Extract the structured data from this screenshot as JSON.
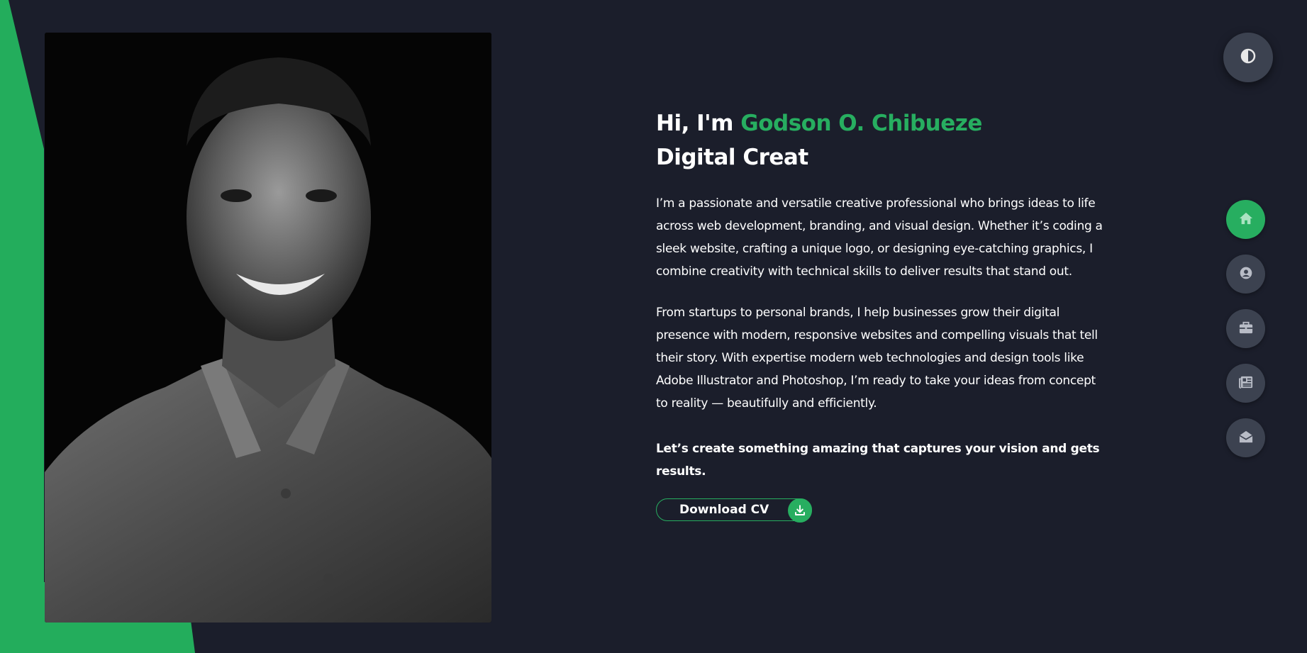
{
  "hero": {
    "greeting": "Hi, I'm ",
    "name": "Godson O. Chibueze",
    "role": "Digital Creat",
    "paragraph_1": "I’m a passionate and versatile creative professional who brings ideas to life across web development, branding, and visual design. Whether it’s coding a sleek website, crafting a unique logo, or designing eye-catching graphics, I combine creativity with technical skills to deliver results that stand out.",
    "paragraph_2": "From startups to personal brands, I help businesses grow their digital presence with modern, responsive websites and compelling visuals that tell their story. With expertise modern web technologies and design tools like Adobe Illustrator and Photoshop, I’m ready to take your ideas from concept to reality — beautifully and efficiently.",
    "tagline": "Let’s create something amazing that captures your vision and gets results.",
    "cv_button_label": "Download CV"
  },
  "nav": {
    "items": [
      {
        "icon": "home-icon",
        "active": true
      },
      {
        "icon": "user-icon",
        "active": false
      },
      {
        "icon": "briefcase-icon",
        "active": false
      },
      {
        "icon": "newspaper-icon",
        "active": false
      },
      {
        "icon": "envelope-open-icon",
        "active": false
      }
    ]
  },
  "colors": {
    "background": "#1b1e2b",
    "accent": "#27ae60",
    "button_bg": "#3c4250"
  }
}
